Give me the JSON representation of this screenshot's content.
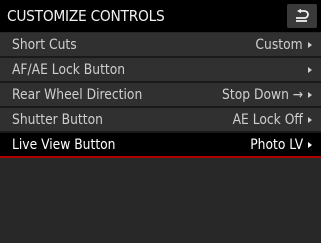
{
  "header": {
    "title": "CUSTOMIZE CONTROLS",
    "back_icon": "back-arrow-icon"
  },
  "menu": {
    "items": [
      {
        "label": "Short Cuts",
        "value": "Custom",
        "selected": false
      },
      {
        "label": "AF/AE Lock Button",
        "value": "",
        "selected": false
      },
      {
        "label": "Rear Wheel Direction",
        "value": "Stop Down →",
        "selected": false
      },
      {
        "label": "Shutter Button",
        "value": "AE Lock Off",
        "selected": false
      },
      {
        "label": "Live View Button",
        "value": "Photo LV",
        "selected": true
      }
    ]
  },
  "colors": {
    "header_bg": "#000000",
    "row_bg": "#303030",
    "selected_bg": "#000000",
    "selected_underline": "#b00000",
    "screen_bg": "#282828"
  }
}
